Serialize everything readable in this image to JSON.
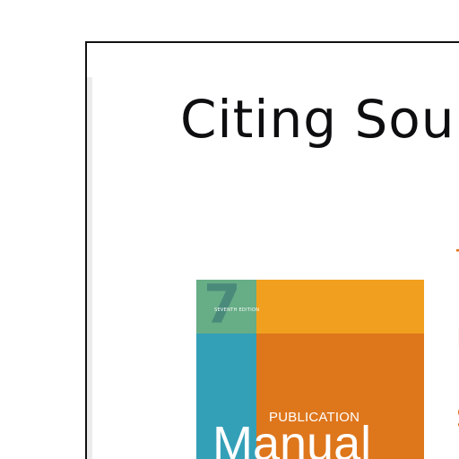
{
  "slide": {
    "title": "Citing Sou",
    "cover": {
      "edition_number": "7",
      "edition_label": "SEVENTH EDITION",
      "publication_label": "PUBLICATION",
      "manual_label": "Manual"
    },
    "bullet_fragments": [
      "T",
      "F",
      "S"
    ]
  },
  "colors": {
    "cover_green": "#67ad86",
    "cover_yellow": "#f0a01e",
    "cover_teal": "#34a0b8",
    "cover_orange": "#de761c",
    "bullet_text": "#de761c"
  }
}
